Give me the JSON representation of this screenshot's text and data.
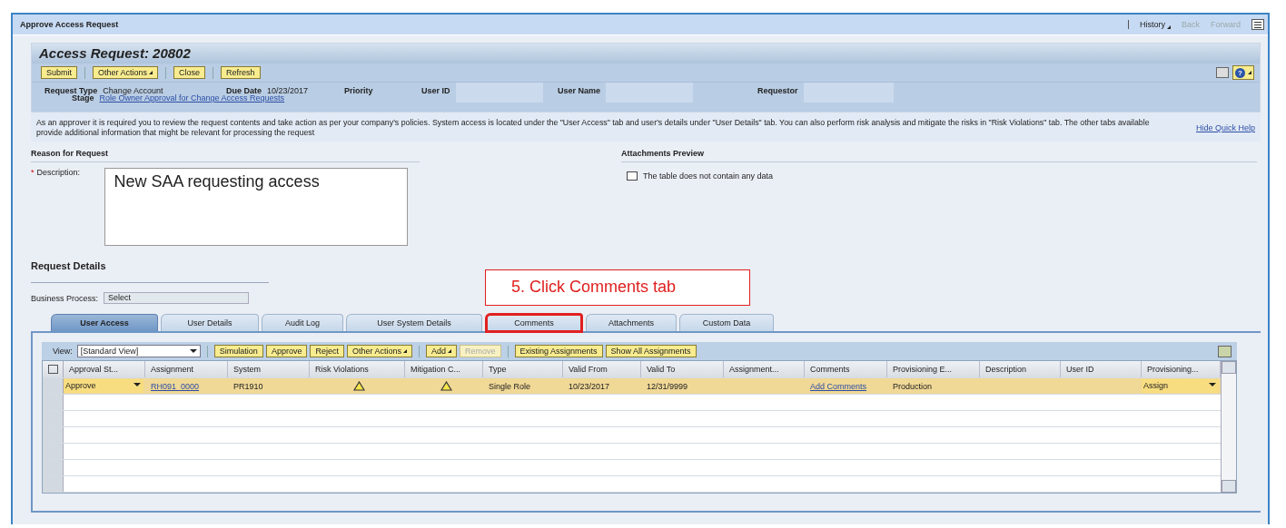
{
  "window": {
    "title": "Approve Access Request",
    "nav": [
      {
        "label": "History",
        "disabled": false,
        "menu": true
      },
      {
        "label": "Back",
        "disabled": true,
        "menu": false
      },
      {
        "label": "Forward",
        "disabled": true,
        "menu": false
      }
    ]
  },
  "header": {
    "title": "Access Request:  20802",
    "help_label": "?",
    "actions": [
      {
        "label": "Submit",
        "menu": false
      },
      {
        "label": "Other Actions",
        "menu": true
      },
      {
        "label": "Close",
        "menu": false
      },
      {
        "label": "Refresh",
        "menu": false
      }
    ],
    "fields": [
      {
        "label": "Request Type",
        "value": "Change Account",
        "kind": "text"
      },
      {
        "label": "Due Date",
        "value": "10/23/2017",
        "kind": "text"
      },
      {
        "label": "Priority",
        "kind": "text"
      },
      {
        "label": "User ID",
        "kind": "redacted"
      },
      {
        "label": "User Name",
        "kind": "redacted"
      },
      {
        "label": "Requestor",
        "kind": "redacted"
      }
    ],
    "stage": {
      "label": "Stage",
      "value": "Role Owner Approval for Change Access Requests"
    }
  },
  "quick_help": {
    "text": "As an approver it is required you to review the request contents and take action as per your company's policies. System access is located under the \"User Access\" tab and user's details under \"User Details\" tab. You can also perform risk analysis and mitigate the risks in \"Risk Violations\" tab. The other tabs available provide additional information that might be relevant for processing the request",
    "hide_link": "Hide Quick Help"
  },
  "reason": {
    "heading": "Reason for Request",
    "required_mark": "*",
    "label": "Description:",
    "value": "New SAA requesting access"
  },
  "attachments": {
    "heading": "Attachments Preview",
    "message": "The table does not contain any data"
  },
  "request_details": {
    "heading": "Request Details",
    "business_process": {
      "label": "Business Process:",
      "value": "Select"
    }
  },
  "annotation": {
    "text": "5. Click Comments tab"
  },
  "tabs": [
    {
      "label": "User Access",
      "selected": true,
      "highlighted": false
    },
    {
      "label": "User Details",
      "selected": false,
      "highlighted": false
    },
    {
      "label": "Audit Log",
      "selected": false,
      "highlighted": false
    },
    {
      "label": "User System Details",
      "selected": false,
      "highlighted": false
    },
    {
      "label": "Comments",
      "selected": false,
      "highlighted": true
    },
    {
      "label": "Attachments",
      "selected": false,
      "highlighted": false
    },
    {
      "label": "Custom Data",
      "selected": false,
      "highlighted": false
    }
  ],
  "table_toolbar": {
    "view_label": "View:",
    "view_value": "[Standard View]",
    "groups": [
      [
        {
          "label": "Simulation",
          "menu": false,
          "disabled": false
        },
        {
          "label": "Approve",
          "menu": false,
          "disabled": false
        },
        {
          "label": "Reject",
          "menu": false,
          "disabled": false
        },
        {
          "label": "Other Actions",
          "menu": true,
          "disabled": false
        }
      ],
      [
        {
          "label": "Add",
          "menu": true,
          "disabled": false
        },
        {
          "label": "Remove",
          "menu": false,
          "disabled": true
        }
      ],
      [
        {
          "label": "Existing Assignments",
          "menu": false,
          "disabled": false
        },
        {
          "label": "Show All Assignments",
          "menu": false,
          "disabled": false
        }
      ]
    ]
  },
  "table": {
    "columns": [
      "Approval St...",
      "Assignment",
      "System",
      "Risk Violations",
      "Mitigation C...",
      "Type",
      "Valid From",
      "Valid To",
      "Assignment...",
      "Comments",
      "Provisioning E...",
      "Description",
      "User ID",
      "Provisioning..."
    ],
    "rows": [
      {
        "selected": true,
        "cells": [
          {
            "kind": "dropdown",
            "text": "Approve"
          },
          {
            "kind": "link",
            "text": "RH091_0000"
          },
          {
            "kind": "text",
            "text": "PR1910"
          },
          {
            "kind": "warning"
          },
          {
            "kind": "warning"
          },
          {
            "kind": "text",
            "text": "Single Role"
          },
          {
            "kind": "text",
            "text": "10/23/2017"
          },
          {
            "kind": "text",
            "text": "12/31/9999"
          },
          {
            "kind": "empty"
          },
          {
            "kind": "link",
            "text": "Add Comments"
          },
          {
            "kind": "text",
            "text": "Production"
          },
          {
            "kind": "empty"
          },
          {
            "kind": "empty"
          },
          {
            "kind": "dropdown",
            "text": "Assign"
          }
        ]
      }
    ]
  }
}
